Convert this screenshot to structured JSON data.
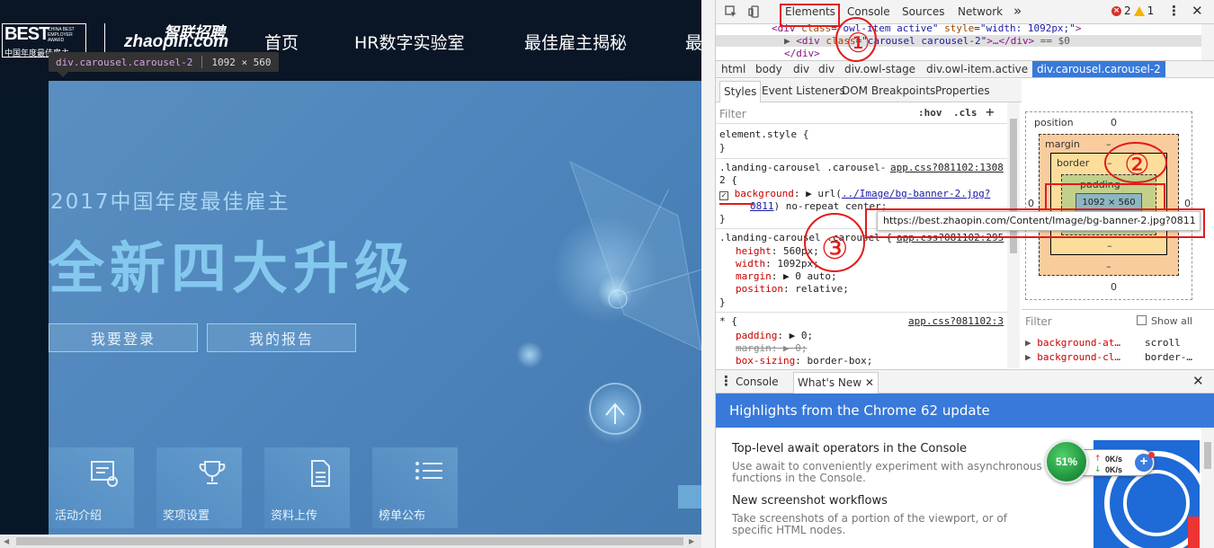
{
  "site": {
    "logo": {
      "best": "BEST",
      "small_lines": "CHINA BEST EMPLOYER AWARD",
      "cn": "中国年度最佳雇主",
      "brand_cn": "智联招聘",
      "brand_en": "zhaopin.com"
    },
    "nav": [
      "首页",
      "HR数字实验室",
      "最佳雇主揭秘",
      "最"
    ],
    "element_tooltip": {
      "tag": "div.carousel.carousel-2",
      "size": "1092 × 560"
    },
    "banner": {
      "subtitle": "2017中国年度最佳雇主",
      "title": "全新四大升级",
      "buttons": [
        "我要登录",
        "我的报告"
      ],
      "tiles": [
        "活动介绍",
        "奖项设置",
        "资料上传",
        "榜单公布"
      ]
    }
  },
  "devtools": {
    "tabs": [
      "Elements",
      "Console",
      "Sources",
      "Network"
    ],
    "more": "»",
    "errors": "2",
    "warnings": "1",
    "dom": {
      "line1": {
        "tag_open": "<div ",
        "attr1": "class",
        "val1": "\"owl-item active\"",
        "attr2": "style",
        "val2": "\"width: 1092px;\"",
        "close": ">"
      },
      "line2": {
        "tag_open": "<div ",
        "attr": "class",
        "val": "\"carousel carousel-2\"",
        "rest": ">…</div>",
        "eq": " == $0"
      },
      "line3": "</div>"
    },
    "breadcrumbs": [
      "html",
      "body",
      "div",
      "div",
      "div.owl-stage",
      "div.owl-item.active",
      "div.carousel.carousel-2"
    ],
    "styles_tabs": [
      "Styles",
      "Event Listeners",
      "DOM Breakpoints",
      "Properties"
    ],
    "filter": {
      "placeholder": "Filter",
      "hov": ":hov",
      "cls": ".cls",
      "plus": "+"
    },
    "rules": {
      "element_style": "element.style {",
      "close": "}",
      "r1_selector": ".landing-carousel .carousel-",
      "r1_selector2": "2 {",
      "r1_source": "app.css?081102:1308",
      "r1_prop": "background",
      "r1_val_pre": ": ▶ url(",
      "r1_url": "../Image/bg-banner-2.jpg?",
      "r1_url2": "0811",
      "r1_val_post": ") no-repeat center;",
      "r2_selector": ".landing-carousel .carousel {",
      "r2_source": "app.css?081102:295",
      "r2_props": [
        {
          "name": "height",
          "value": ": 560px;"
        },
        {
          "name": "width",
          "value": ": 1092px;"
        },
        {
          "name": "margin",
          "value": ": ▶ 0 auto;"
        },
        {
          "name": "position",
          "value": ": relative;"
        }
      ],
      "r3_selector": "* {",
      "r3_source": "app.css?081102:3",
      "r3_props": [
        {
          "name": "padding",
          "value": ": ▶ 0;"
        },
        {
          "name": "margin",
          "value": ": ▶ 0;",
          "struck": true
        },
        {
          "name": "box-sizing",
          "value": ": border-box;"
        }
      ]
    },
    "box_model": {
      "position_label": "position",
      "position_val": "0",
      "margin_label": "margin",
      "margin_val": "–",
      "border_label": "border",
      "border_val": "–",
      "padding_label": "padding",
      "content": "1092 × 560",
      "side_zero": "0",
      "dash": "–",
      "bottom_zero": "0"
    },
    "url_tooltip": "https://best.zhaopin.com/Content/Image/bg-banner-2.jpg?0811",
    "computed": {
      "filter": "Filter",
      "show_all": "Show all",
      "rows": [
        {
          "name": "background-at…",
          "value": "scroll"
        },
        {
          "name": "background-cl…",
          "value": "border-…"
        }
      ]
    },
    "drawer_tabs": [
      "Console",
      "What's New"
    ],
    "whats_new": {
      "banner": "Highlights from the Chrome 62 update",
      "items": [
        {
          "title": "Top-level await operators in the Console",
          "desc": "Use await to conveniently experiment with asynchronous functions in the Console."
        },
        {
          "title": "New screenshot workflows",
          "desc": "Take screenshots of a portion of the viewport, or of specific HTML nodes."
        }
      ]
    }
  },
  "speed_widget": {
    "percent": "51%",
    "up": "0K/s",
    "down": "0K/s",
    "plus": "+"
  },
  "annotations": {
    "mark1": "①",
    "mark2": "②",
    "mark3": "③"
  },
  "colors": {
    "accent": "#3879d9",
    "annotation": "#e21b1b",
    "banner": "#4e86bd"
  }
}
